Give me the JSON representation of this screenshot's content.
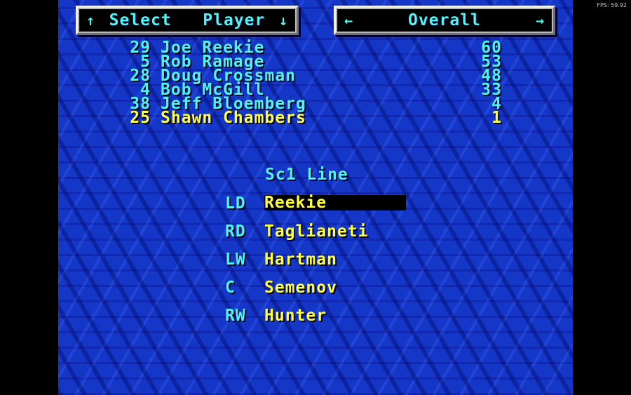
{
  "fps_label": "FPS: 59.92",
  "header": {
    "left": {
      "arrow_up": "↑",
      "label": "Select   Player",
      "arrow_down": "↓"
    },
    "right": {
      "arrow_left": "←",
      "label": "Overall",
      "arrow_right": "→"
    }
  },
  "roster": [
    {
      "number": "29",
      "name": "Joe Reekie",
      "value": "60",
      "selected": false
    },
    {
      "number": "5",
      "name": "Rob Ramage",
      "value": "53",
      "selected": false
    },
    {
      "number": "28",
      "name": "Doug Crossman",
      "value": "48",
      "selected": false
    },
    {
      "number": "4",
      "name": "Bob McGill",
      "value": "33",
      "selected": false
    },
    {
      "number": "38",
      "name": "Jeff Bloemberg",
      "value": "4",
      "selected": false
    },
    {
      "number": "25",
      "name": "Shawn Chambers",
      "value": "1",
      "selected": true
    }
  ],
  "line": {
    "title": "Sc1 Line",
    "slots": [
      {
        "pos": "LD",
        "player": "Reekie",
        "active": true
      },
      {
        "pos": "RD",
        "player": "Taglianeti",
        "active": false
      },
      {
        "pos": "LW",
        "player": "Hartman",
        "active": false
      },
      {
        "pos": "C",
        "player": "Semenov",
        "active": false
      },
      {
        "pos": "RW",
        "player": "Hunter",
        "active": false
      }
    ]
  },
  "colors": {
    "background": "#1437c8",
    "cyan_text": "#4ff5f5",
    "yellow_text": "#ffff40",
    "highlight_bar": "#000000"
  }
}
